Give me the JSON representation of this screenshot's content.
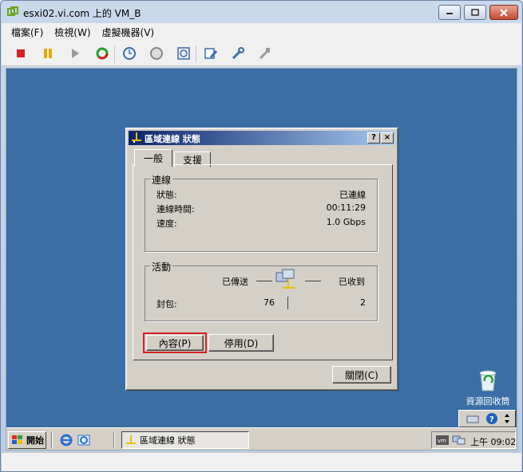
{
  "window": {
    "title": "esxi02.vi.com 上的 VM_B"
  },
  "menu": {
    "items": [
      "檔案(F)",
      "檢視(W)",
      "虛擬機器(V)"
    ]
  },
  "toolbar": {
    "buttons": [
      "power-off",
      "suspend",
      "power-on",
      "reset",
      "snapshot",
      "revert-snapshot",
      "manage-snapshots",
      "edit-settings",
      "vm-tools",
      "connect-devices"
    ]
  },
  "dialog": {
    "title": "區域連線 狀態",
    "help_button": "?",
    "close_button": "×",
    "tabs": [
      "一般",
      "支援"
    ],
    "connection": {
      "legend": "連線",
      "rows": [
        {
          "label": "狀態:",
          "value": "已連線"
        },
        {
          "label": "連線時間:",
          "value": "00:11:29"
        },
        {
          "label": "速度:",
          "value": "1.0 Gbps"
        }
      ]
    },
    "activity": {
      "legend": "活動",
      "sent_label": "已傳送",
      "received_label": "已收到",
      "packets_label": "封包:",
      "packets_sent": "76",
      "packets_received": "2"
    },
    "buttons": {
      "properties": "內容(P)",
      "disable": "停用(D)",
      "close": "關閉(C)"
    }
  },
  "desktop": {
    "recycle_bin_label": "資源回收筒"
  },
  "taskbar": {
    "start_label": "開始",
    "task_label": "區域連線 狀態",
    "clock": "上午 09:02"
  },
  "colors": {
    "desktop": "#3a6ea5",
    "dialog_title_start": "#0a246a",
    "dialog_title_end": "#a6caf0",
    "focus_highlight": "#d42020"
  }
}
